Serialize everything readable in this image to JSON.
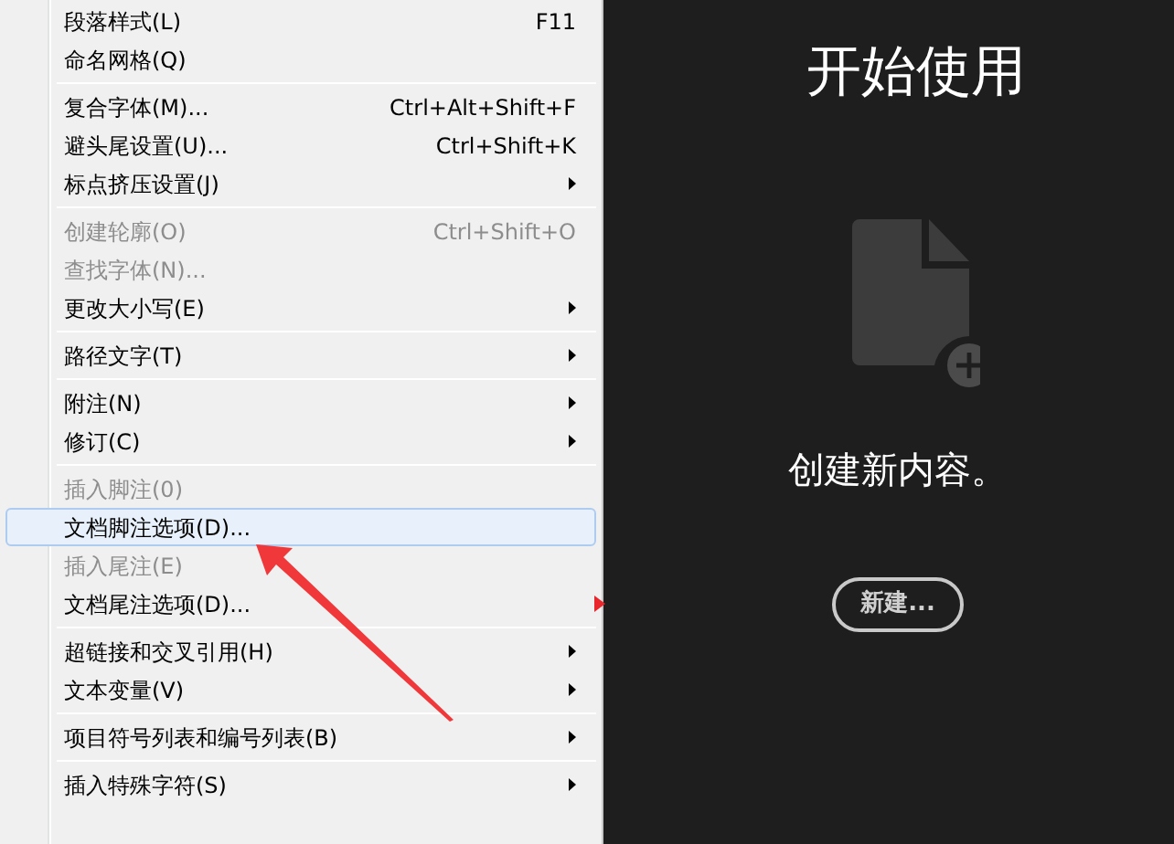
{
  "menu": {
    "items": [
      {
        "kind": "item",
        "label": "段落样式(L)",
        "shortcut": "F11",
        "submenu": false,
        "disabled": false,
        "selected": false
      },
      {
        "kind": "item",
        "label": "命名网格(Q)",
        "submenu": false,
        "disabled": false,
        "selected": false
      },
      {
        "kind": "separator"
      },
      {
        "kind": "item",
        "label": "复合字体(M)...",
        "shortcut": "Ctrl+Alt+Shift+F",
        "submenu": false,
        "disabled": false,
        "selected": false
      },
      {
        "kind": "item",
        "label": "避头尾设置(U)...",
        "shortcut": "Ctrl+Shift+K",
        "submenu": false,
        "disabled": false,
        "selected": false
      },
      {
        "kind": "item",
        "label": "标点挤压设置(J)",
        "submenu": true,
        "disabled": false,
        "selected": false
      },
      {
        "kind": "separator"
      },
      {
        "kind": "item",
        "label": "创建轮廓(O)",
        "shortcut": "Ctrl+Shift+O",
        "submenu": false,
        "disabled": true,
        "selected": false
      },
      {
        "kind": "item",
        "label": "查找字体(N)...",
        "submenu": false,
        "disabled": true,
        "selected": false
      },
      {
        "kind": "item",
        "label": "更改大小写(E)",
        "submenu": true,
        "disabled": false,
        "selected": false
      },
      {
        "kind": "separator"
      },
      {
        "kind": "item",
        "label": "路径文字(T)",
        "submenu": true,
        "disabled": false,
        "selected": false
      },
      {
        "kind": "separator"
      },
      {
        "kind": "item",
        "label": "附注(N)",
        "submenu": true,
        "disabled": false,
        "selected": false
      },
      {
        "kind": "item",
        "label": "修订(C)",
        "submenu": true,
        "disabled": false,
        "selected": false
      },
      {
        "kind": "separator"
      },
      {
        "kind": "item",
        "label": "插入脚注(0)",
        "submenu": false,
        "disabled": true,
        "selected": false
      },
      {
        "kind": "item",
        "label": "文档脚注选项(D)...",
        "submenu": false,
        "disabled": false,
        "selected": true
      },
      {
        "kind": "item",
        "label": "插入尾注(E)",
        "submenu": false,
        "disabled": true,
        "selected": false
      },
      {
        "kind": "item",
        "label": "文档尾注选项(D)...",
        "submenu": false,
        "disabled": false,
        "selected": false
      },
      {
        "kind": "separator"
      },
      {
        "kind": "item",
        "label": "超链接和交叉引用(H)",
        "submenu": true,
        "disabled": false,
        "selected": false
      },
      {
        "kind": "item",
        "label": "文本变量(V)",
        "submenu": true,
        "disabled": false,
        "selected": false
      },
      {
        "kind": "separator"
      },
      {
        "kind": "item",
        "label": "项目符号列表和编号列表(B)",
        "submenu": true,
        "disabled": false,
        "selected": false
      },
      {
        "kind": "separator"
      },
      {
        "kind": "item",
        "label": "插入特殊字符(S)",
        "submenu": true,
        "disabled": false,
        "selected": false
      }
    ]
  },
  "start_panel": {
    "title": "开始使用",
    "message": "创建新内容。",
    "button": "新建..."
  }
}
